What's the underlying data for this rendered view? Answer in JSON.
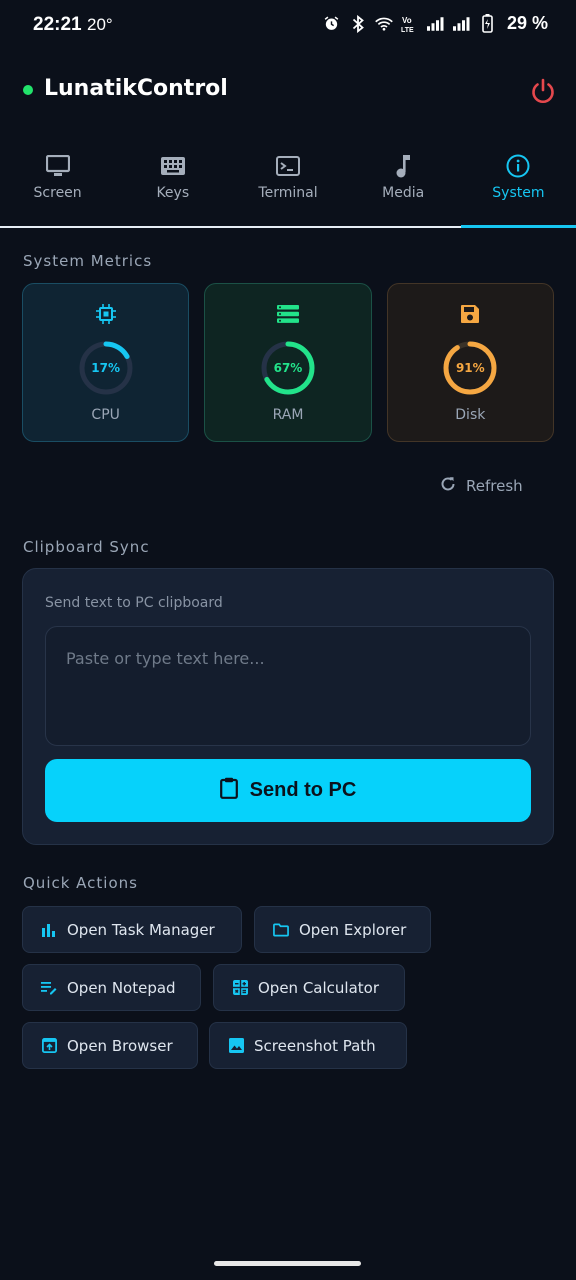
{
  "status_bar": {
    "time": "22:21",
    "temperature": "20°",
    "battery": "29 %",
    "icons": [
      "alarm-icon",
      "bluetooth-icon",
      "wifi-icon",
      "volte-icon",
      "signal-icon",
      "signal-icon",
      "battery-charging-icon"
    ]
  },
  "header": {
    "title": "LunatikControl",
    "status_color": "#22e36b",
    "power_color": "#e5484d"
  },
  "tabs": [
    {
      "label": "Screen",
      "icon": "monitor-icon",
      "active": false
    },
    {
      "label": "Keys",
      "icon": "keyboard-icon",
      "active": false
    },
    {
      "label": "Terminal",
      "icon": "terminal-icon",
      "active": false
    },
    {
      "label": "Media",
      "icon": "music-note-icon",
      "active": false
    },
    {
      "label": "System",
      "icon": "info-icon",
      "active": true
    }
  ],
  "system_metrics": {
    "title": "System Metrics",
    "items": [
      {
        "label": "CPU",
        "value_text": "17%",
        "fraction": 0.17,
        "color": "#16c6f2",
        "icon": "cpu-chip-icon"
      },
      {
        "label": "RAM",
        "value_text": "67%",
        "fraction": 0.67,
        "color": "#22e38a",
        "icon": "memory-icon"
      },
      {
        "label": "Disk",
        "value_text": "91%",
        "fraction": 0.91,
        "color": "#f5a742",
        "icon": "floppy-disk-icon"
      }
    ],
    "refresh_label": "Refresh"
  },
  "clipboard": {
    "title": "Clipboard Sync",
    "hint": "Send text to PC clipboard",
    "placeholder": "Paste or type text here...",
    "value": "",
    "send_label": "Send to PC"
  },
  "quick_actions": {
    "title": "Quick Actions",
    "items": [
      {
        "label": "Open Task Manager",
        "icon": "bar-chart-icon"
      },
      {
        "label": "Open Explorer",
        "icon": "folder-icon"
      },
      {
        "label": "Open Notepad",
        "icon": "notes-edit-icon"
      },
      {
        "label": "Open Calculator",
        "icon": "calculator-icon"
      },
      {
        "label": "Open Browser",
        "icon": "browser-window-icon"
      },
      {
        "label": "Screenshot Path",
        "icon": "image-icon"
      }
    ]
  },
  "colors": {
    "accent": "#16c6f2",
    "button": "#06d2fb",
    "background": "#0b101a"
  }
}
